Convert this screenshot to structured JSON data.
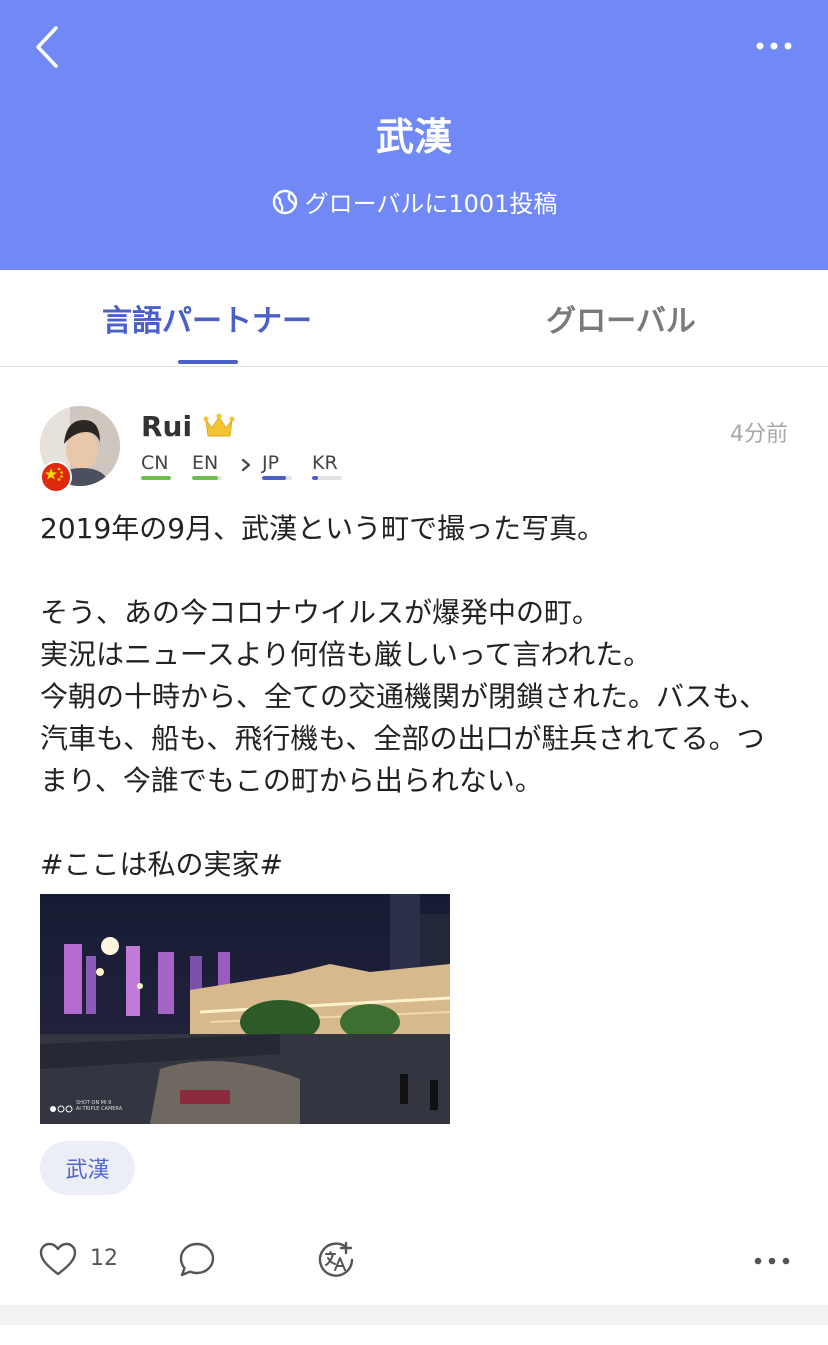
{
  "header": {
    "title": "武漢",
    "subtitle": "グローバルに1001投稿",
    "background_color": "#7089f6",
    "back_icon": "chevron-left-icon",
    "more_icon": "ellipsis-icon",
    "globe_icon": "globe-icon"
  },
  "tabs": [
    {
      "label": "言語パートナー",
      "active": true
    },
    {
      "label": "グローバル",
      "active": false
    }
  ],
  "post": {
    "username": "Rui",
    "badge_icon": "crown-icon",
    "country_flag": "china-flag-icon",
    "time": "4分前",
    "languages": {
      "native": [
        {
          "code": "CN",
          "level": 1.0,
          "color": "#6cc04a"
        },
        {
          "code": "EN",
          "level": 0.85,
          "color": "#6cc04a"
        }
      ],
      "learning": [
        {
          "code": "JP",
          "level": 0.8,
          "color": "#4a5fc9"
        },
        {
          "code": "KR",
          "level": 0.2,
          "color": "#4a5fc9"
        }
      ]
    },
    "text": "2019年の9月、武漢という町で撮った写真。\n\nそう、あの今コロナウイルスが爆発中の町。\n実況はニュースより何倍も厳しいって言われた。\n今朝の十時から、全ての交通機関が閉鎖された。バスも、汽車も、船も、飛行機も、全部の出口が駐兵されてる。つまり、今誰でもこの町から出られない。\n\n#ここは私の実家#",
    "photo_watermark_line1": "SHOT ON MI 9",
    "photo_watermark_line2": "AI TRIPLE CAMERA",
    "tag": "武漢",
    "like_count": "12",
    "like_icon": "heart-icon",
    "comment_icon": "comment-icon",
    "translate_icon": "translate-icon",
    "more_icon": "ellipsis-icon"
  },
  "colors": {
    "accent": "#4a5fc9",
    "native_bar": "#6cc04a"
  }
}
